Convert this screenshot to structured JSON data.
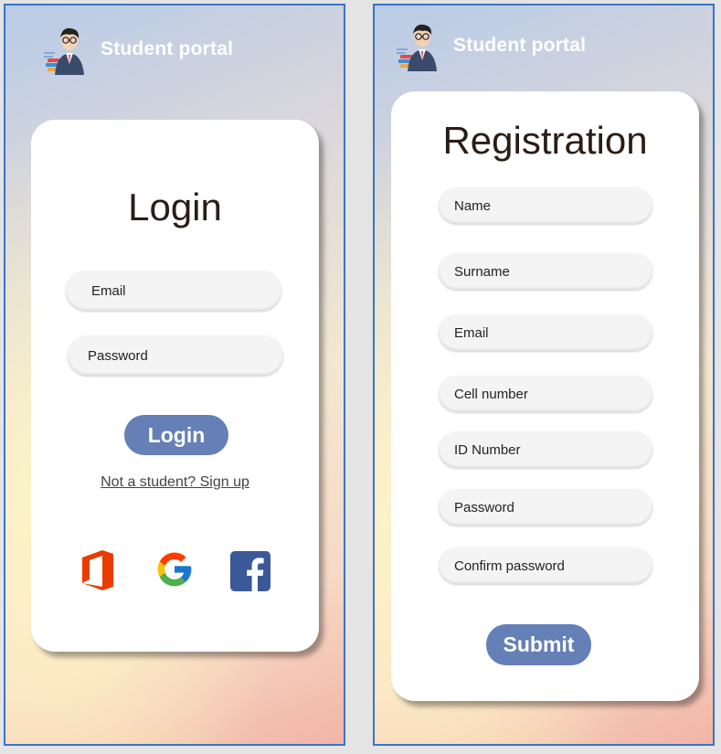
{
  "app": {
    "title": "Student portal"
  },
  "login": {
    "title": "Login",
    "email_placeholder": "Email",
    "password_placeholder": "Password",
    "submit_label": "Login",
    "signup_link": "Not a student? Sign up",
    "social": [
      "office-icon",
      "google-icon",
      "facebook-icon"
    ]
  },
  "registration": {
    "title": "Registration",
    "fields": [
      "Name",
      "Surname",
      "Email",
      "Cell number",
      "ID Number",
      "Password",
      "Confirm password"
    ],
    "submit_label": "Submit"
  },
  "colors": {
    "frame_border": "#3a73c9",
    "button": "#6580b6",
    "title_text": "#2a1d16",
    "office": "#eb3c00",
    "facebook": "#3b5998"
  }
}
